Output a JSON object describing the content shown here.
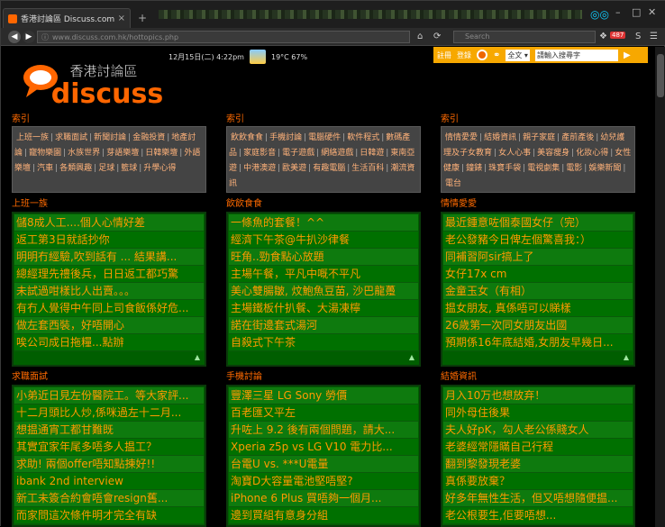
{
  "browser": {
    "tab_title": "香港討論區 Discuss.com.hk - 香...",
    "tab_close": "×",
    "new_tab": "+",
    "url": "www.discuss.com.hk/hottopics.php",
    "search_placeholder": "Search",
    "badge": "487"
  },
  "topbar": {
    "date": "12月15日(二) 4:22pm",
    "weather": "19°C 67%",
    "register": "註冊",
    "login": "登錄",
    "select": "全文 ▾",
    "search_placeholder": "請輸入搜尋字"
  },
  "logo": {
    "chinese": "香港討論區",
    "english": "discuss"
  },
  "columns": [
    {
      "index_title": "索引",
      "categories": [
        "上班一族",
        "求職面試",
        "新聞討論",
        "金融投資",
        "地產討論",
        "寵物樂園",
        "水族世界",
        "芽語樂壇",
        "日韓樂壇",
        "外語樂壇",
        "汽車",
        "各類興趣",
        "足球",
        "籃球",
        "升學心得"
      ],
      "group_title": "上班一族",
      "posts": [
        "儲8成人工....個人心情好差",
        "返工第3日就話抄你",
        "明明冇經驗,吹到話有 ... 結果講...",
        "總經理先禮後兵，日日返工都巧驚",
        "未試過咁樣比人出賣。。。",
        "有冇人覺得中午同上司食飯係好危...",
        "做左套西裝，好唔開心",
        "唉公司成日拖糧...點辦"
      ],
      "group2_title": "求職面試",
      "posts2": [
        "小弟近日見左份醫院工。等大家評...",
        "十二月頭比人炒,係咪過左十二月...",
        "想揾通宵工都甘難既",
        "其實宜家年尾多唔多人揾工？",
        "求助! 兩個offer唔知點揀好!!",
        "ibank 2nd interview",
        "新工未簽合約會唔會resign舊...",
        "而家問這次條件明才完全有缺"
      ]
    },
    {
      "index_title": "索引",
      "categories": [
        "飲飲食食",
        "手機討論",
        "電腦硬件",
        "軟件程式",
        "數碼產品",
        "家庭影音",
        "電子遊戲",
        "網絡遊戲",
        "日韓遊",
        "東南亞遊",
        "中港澳遊",
        "歐美遊",
        "有趣電腦",
        "生活百科",
        "潮流資訊"
      ],
      "group_title": "飲飲食食",
      "posts": [
        "一條魚的套餐！^^",
        "經濟下午茶@牛扒沙律餐",
        "旺角..勁食點心放題",
        "主場午餐，平凡中嘅不平凡",
        "美心雙腸皺, 炆鮑魚豆苗, 沙巴龍躉",
        "主場鐵板什扒餐、大湯凍檸",
        "諾在街邊套式湯河",
        "自殺式下午茶"
      ],
      "group2_title": "手機討論",
      "posts2": [
        "豐澤三星 LG Sony 勞價",
        "百老匯又平左",
        "升咗上 9.2 後有兩個問題，請大...",
        "Xperia z5p vs LG V10 電力比...",
        "台電U vs. ***U電量",
        "淘寶D大容量電池堅唔堅?",
        "iPhone 6 Plus 買唔夠一個月...",
        "邊到買組有意身分組"
      ]
    },
    {
      "index_title": "索引",
      "categories": [
        "情情愛愛",
        "結婚資訊",
        "親子家庭",
        "產前產後",
        "幼兒護理及子女教育",
        "女人心事",
        "美容瘦身",
        "化妝心得",
        "女性健康",
        "鐘錶",
        "珠寶手袋",
        "電視劇集",
        "電影",
        "娛樂新聞",
        "電台"
      ],
      "group_title": "情情愛愛",
      "posts": [
        "最近鍾意咗個泰國女仔（完）",
        "老公發豬今日俾左個驚喜我：）",
        "同補習阿sir搞上了",
        "女仔17x cm",
        "金童玉女（有相）",
        "揾女朋友, 真係唔可以睇樣",
        "26歲第一次同女朋友出國",
        "預期係16年底結婚,女朋友早幾日..."
      ],
      "group2_title": "結婚資訊",
      "posts2": [
        "月入10万也想放弃！",
        "同外母住後果",
        "夫人好pK，勾人老公係賤女人",
        "老婆經常隱瞞自己行程",
        "翻到黎發現老婆",
        "真係要放棄？",
        "好多年無性生活，但又唔想隨便揾...",
        "老公根要生,佢要唔想..."
      ]
    }
  ]
}
